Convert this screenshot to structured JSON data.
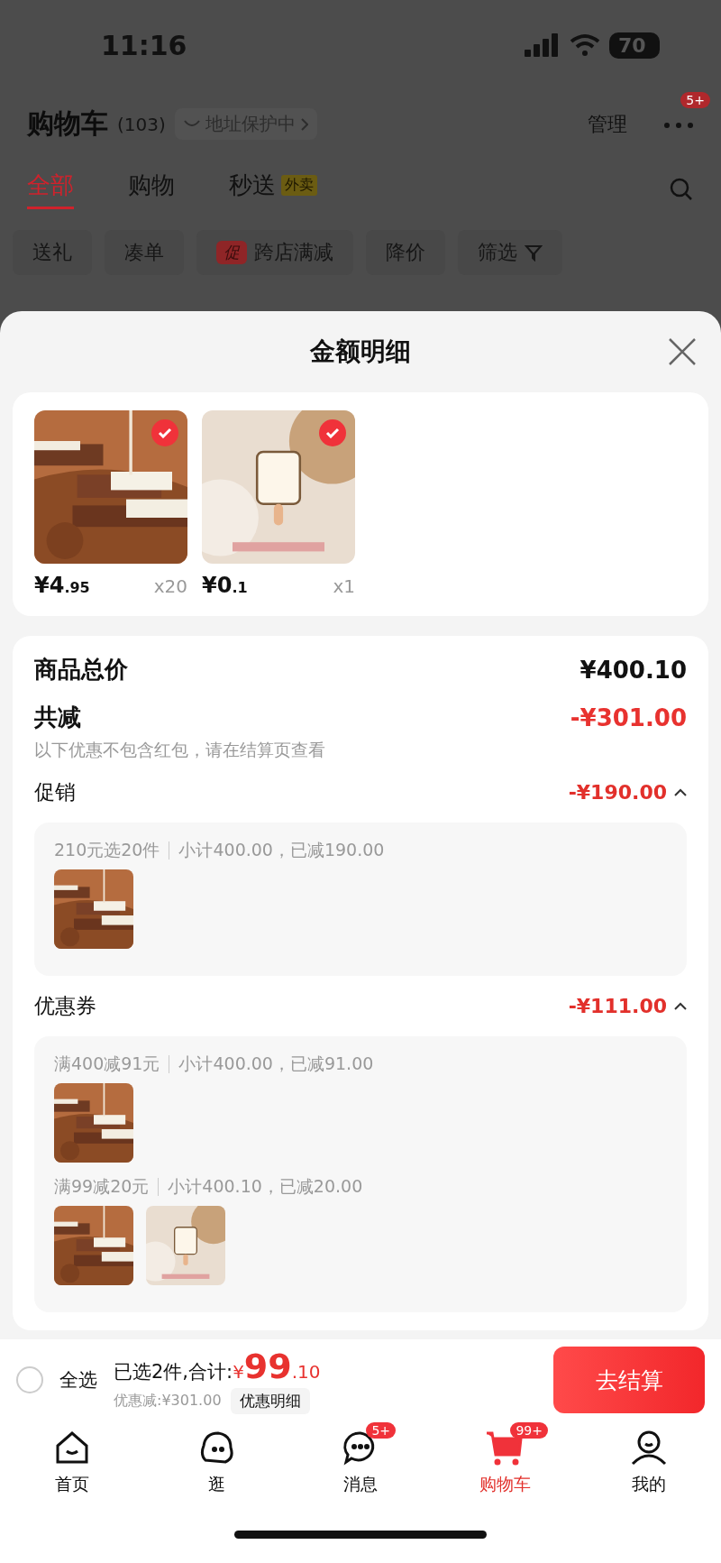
{
  "status_bar": {
    "time": "11:16",
    "battery": "70"
  },
  "header": {
    "title": "购物车",
    "count": "(103)",
    "address": "地址保护中",
    "manage": "管理",
    "more_badge": "5+"
  },
  "tabs": [
    {
      "label": "全部",
      "selected": true
    },
    {
      "label": "购物",
      "selected": false
    },
    {
      "label": "秒送",
      "selected": false,
      "tag": "外卖"
    }
  ],
  "chips": [
    {
      "kind": "plain",
      "label": "送礼"
    },
    {
      "kind": "plain",
      "label": "凑单"
    },
    {
      "kind": "promo",
      "badge": "促",
      "label": "跨店满减"
    },
    {
      "kind": "plain",
      "label": "降价"
    },
    {
      "kind": "filter",
      "label": "筛选"
    }
  ],
  "sheet": {
    "title": "金额明细"
  },
  "products": [
    {
      "price_integer": "¥4",
      "price_decimal": ".95",
      "quantity": "x20",
      "checked": true
    },
    {
      "price_integer": "¥0",
      "price_decimal": ".1",
      "quantity": "x1",
      "checked": true
    }
  ],
  "total": {
    "label": "商品总价",
    "amount": "¥400.10"
  },
  "discount": {
    "label": "共减",
    "amount": "-¥301.00",
    "note": "以下优惠不包含红包，请在结算页查看"
  },
  "sections": [
    {
      "label": "促销",
      "amount": "-¥190.00",
      "expanded": true,
      "groups": [
        {
          "rule": "210元选20件",
          "subtotal": "小计400.00，已减190.00"
        }
      ]
    },
    {
      "label": "优惠券",
      "amount": "-¥111.00",
      "expanded": true,
      "groups": [
        {
          "rule": "满400减91元",
          "subtotal": "小计400.00，已减91.00"
        },
        {
          "rule": "满99减20元",
          "subtotal": "小计400.10，已减20.00"
        }
      ]
    }
  ],
  "bottom_bar": {
    "select_all": {
      "label": "全选",
      "checked": false
    },
    "selected_text": "已选2件,合计:",
    "currency": "¥",
    "total_integer": "99",
    "total_decimal": ".10",
    "saved": "优惠减:¥301.00",
    "detail_button": "优惠明细",
    "checkout": "去结算"
  },
  "nav": [
    {
      "label": "首页",
      "selected": false
    },
    {
      "label": "逛",
      "selected": false
    },
    {
      "label": "消息",
      "selected": false,
      "badge": "5+"
    },
    {
      "label": "购物车",
      "selected": true,
      "badge": "99+"
    },
    {
      "label": "我的",
      "selected": false
    }
  ]
}
